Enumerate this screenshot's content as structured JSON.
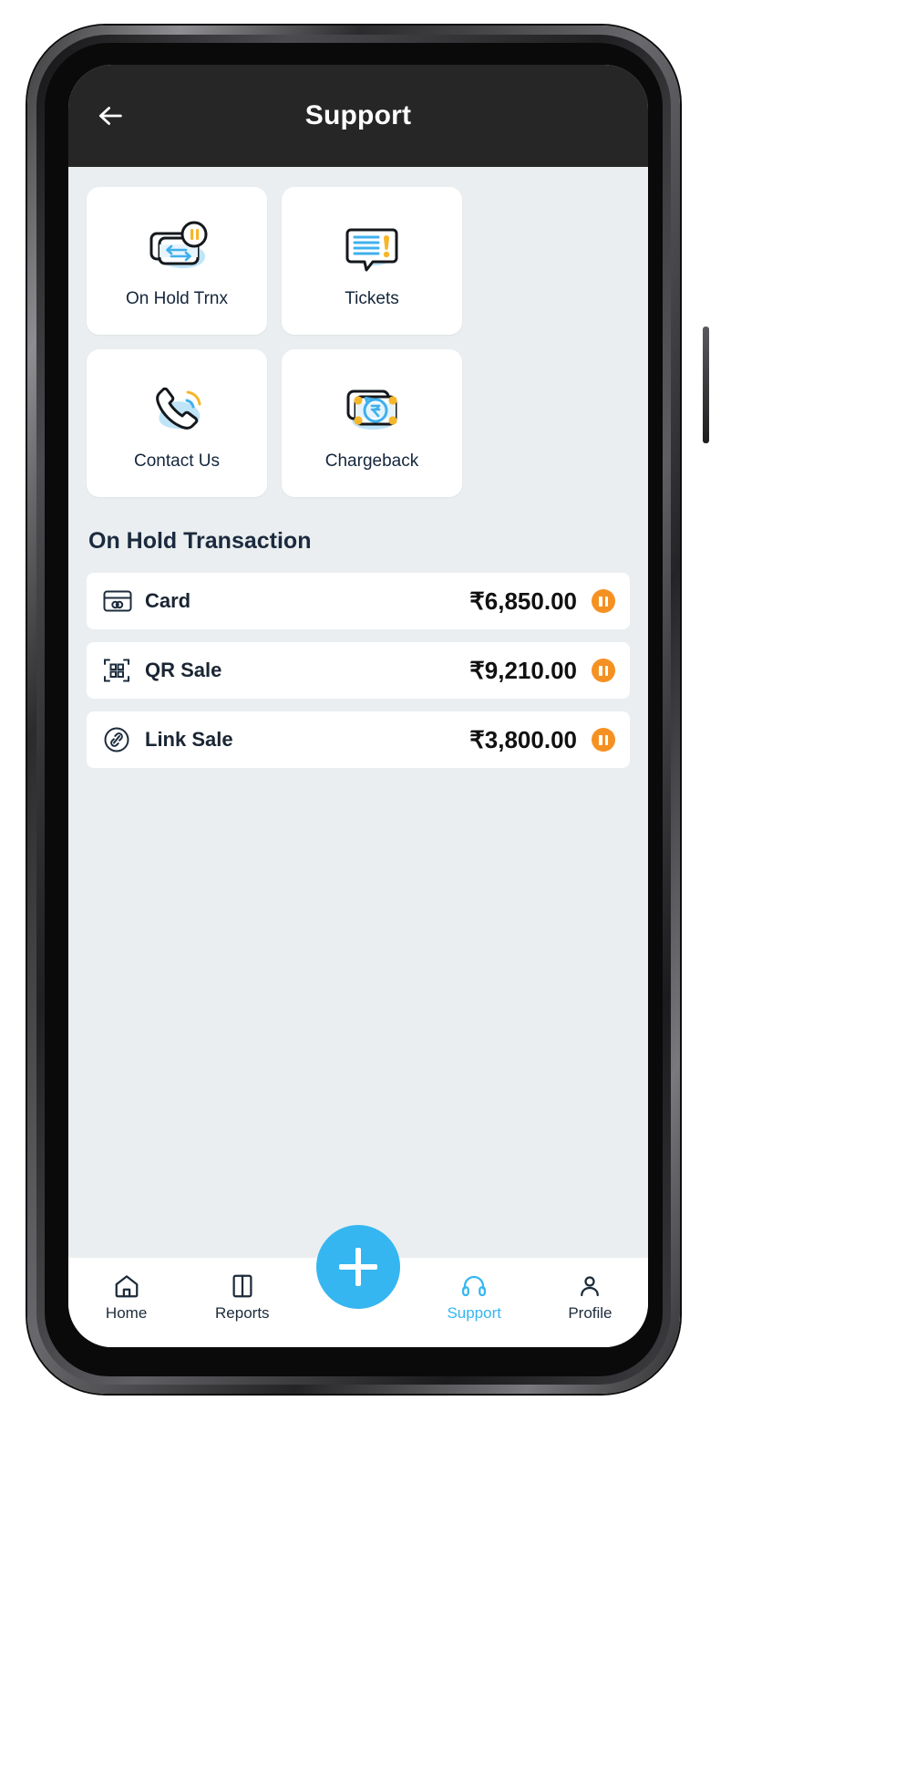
{
  "header": {
    "title": "Support",
    "back_icon": "arrow-left-icon"
  },
  "tiles": [
    {
      "label": "On Hold Trnx",
      "icon": "on-hold-transaction-icon"
    },
    {
      "label": "Tickets",
      "icon": "ticket-chat-icon"
    },
    {
      "label": "Contact Us",
      "icon": "phone-call-icon"
    },
    {
      "label": "Chargeback",
      "icon": "chargeback-money-icon"
    }
  ],
  "section": {
    "title": "On Hold Transaction"
  },
  "transactions": [
    {
      "label": "Card",
      "amount": "₹6,850.00",
      "icon": "credit-card-icon",
      "status": "on-hold"
    },
    {
      "label": "QR Sale",
      "amount": "₹9,210.00",
      "icon": "qr-code-icon",
      "status": "on-hold"
    },
    {
      "label": "Link Sale",
      "amount": "₹3,800.00",
      "icon": "link-icon",
      "status": "on-hold"
    }
  ],
  "bottom_nav": {
    "items": [
      {
        "label": "Home",
        "icon": "home-icon",
        "active": false
      },
      {
        "label": "Reports",
        "icon": "book-icon",
        "active": false
      },
      {
        "label": "Support",
        "icon": "headset-icon",
        "active": true
      },
      {
        "label": "Profile",
        "icon": "person-icon",
        "active": false
      }
    ],
    "fab": {
      "icon": "plus-icon"
    }
  },
  "colors": {
    "accent": "#35b6f1",
    "status_hold": "#f59123",
    "appbar": "#262626",
    "page_bg": "#eaeef0",
    "text_dark": "#1a2533"
  }
}
